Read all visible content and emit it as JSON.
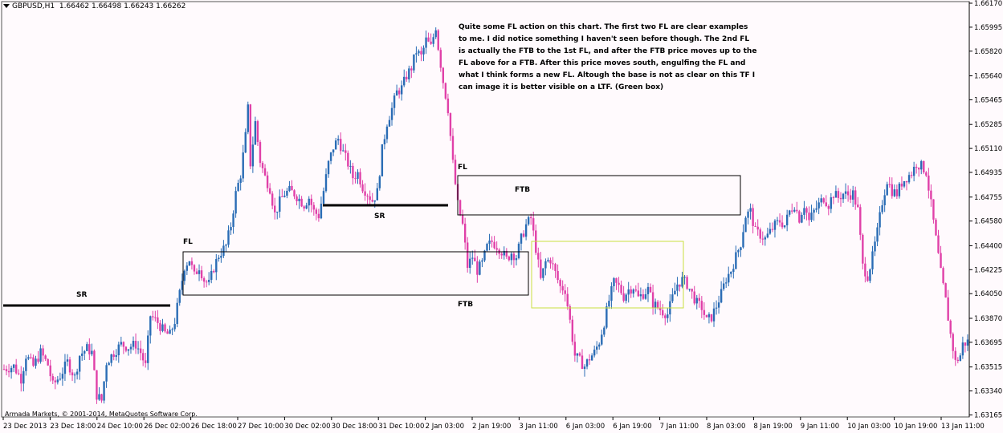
{
  "header": {
    "symbol": "GBPUSD,H1",
    "ohlc": "1.66462 1.66498 1.66243 1.66262"
  },
  "annotation_note": "Quite some FL action on this chart. The first two FL are clear examples to me. I did notice something I haven't seen before though. The 2nd FL is actually the FTB to the 1st FL, and after the FTB price moves up to the FL above for a FTB. After this price moves south, engulfing the FL and what I think forms a new FL. Altough the base is not as clear on this TF I can image it is better visible on a LTF. (Green box)",
  "copyright": "Armada Markets, © 2001-2014, MetaQuotes Software Corp.",
  "colors": {
    "background": "#fffafd",
    "bull_candle": "#2a6cb5",
    "bear_candle": "#e040a8",
    "green_box": "#c8e040",
    "zone_border": "#000000"
  },
  "chart_data": {
    "type": "candlestick",
    "title": "",
    "xlabel": "",
    "ylabel": "",
    "ylim": [
      1.6315,
      1.6617
    ],
    "y_ticks": [
      "1.66170",
      "1.65995",
      "1.65820",
      "1.65640",
      "1.65465",
      "1.65285",
      "1.65110",
      "1.64935",
      "1.64755",
      "1.64580",
      "1.64400",
      "1.64225",
      "1.64050",
      "1.63870",
      "1.63695",
      "1.63515",
      "1.63340",
      "1.63165"
    ],
    "x_ticks": [
      "23 Dec 2013",
      "23 Dec 18:00",
      "24 Dec 10:00",
      "26 Dec 02:00",
      "26 Dec 18:00",
      "27 Dec 10:00",
      "30 Dec 02:00",
      "30 Dec 18:00",
      "31 Dec 10:00",
      "2 Jan 03:00",
      "2 Jan 19:00",
      "3 Jan 11:00",
      "6 Jan 03:00",
      "6 Jan 19:00",
      "7 Jan 11:00",
      "8 Jan 03:00",
      "8 Jan 19:00",
      "9 Jan 11:00",
      "10 Jan 03:00",
      "10 Jan 19:00",
      "13 Jan 11:00"
    ],
    "waypoints": [
      [
        0,
        1.635
      ],
      [
        4,
        1.6352
      ],
      [
        7,
        1.6343
      ],
      [
        9,
        1.636
      ],
      [
        12,
        1.6352
      ],
      [
        15,
        1.6362
      ],
      [
        18,
        1.6353
      ],
      [
        20,
        1.6338
      ],
      [
        23,
        1.6345
      ],
      [
        26,
        1.6355
      ],
      [
        29,
        1.6344
      ],
      [
        31,
        1.636
      ],
      [
        34,
        1.6365
      ],
      [
        36,
        1.6362
      ],
      [
        38,
        1.6331
      ],
      [
        40,
        1.6327
      ],
      [
        42,
        1.6355
      ],
      [
        45,
        1.6362
      ],
      [
        48,
        1.6368
      ],
      [
        51,
        1.6366
      ],
      [
        54,
        1.6368
      ],
      [
        56,
        1.6362
      ],
      [
        58,
        1.6352
      ],
      [
        60,
        1.6389
      ],
      [
        63,
        1.6384
      ],
      [
        66,
        1.6376
      ],
      [
        68,
        1.6375
      ],
      [
        70,
        1.6385
      ],
      [
        72,
        1.6405
      ],
      [
        74,
        1.6425
      ],
      [
        76,
        1.643
      ],
      [
        78,
        1.6418
      ],
      [
        80,
        1.6425
      ],
      [
        82,
        1.6415
      ],
      [
        84,
        1.6412
      ],
      [
        86,
        1.6424
      ],
      [
        88,
        1.6433
      ],
      [
        91,
        1.644
      ],
      [
        93,
        1.6455
      ],
      [
        95,
        1.6478
      ],
      [
        97,
        1.6492
      ],
      [
        99,
        1.652
      ],
      [
        100,
        1.654
      ],
      [
        101,
        1.65
      ],
      [
        103,
        1.653
      ],
      [
        105,
        1.6502
      ],
      [
        107,
        1.649
      ],
      [
        109,
        1.6482
      ],
      [
        111,
        1.6463
      ],
      [
        113,
        1.6472
      ],
      [
        115,
        1.6478
      ],
      [
        117,
        1.648
      ],
      [
        119,
        1.6478
      ],
      [
        121,
        1.6474
      ],
      [
        123,
        1.647
      ],
      [
        125,
        1.6475
      ],
      [
        127,
        1.6465
      ],
      [
        129,
        1.6462
      ],
      [
        131,
        1.648
      ],
      [
        133,
        1.65
      ],
      [
        135,
        1.6512
      ],
      [
        137,
        1.6518
      ],
      [
        139,
        1.6508
      ],
      [
        141,
        1.65
      ],
      [
        143,
        1.649
      ],
      [
        145,
        1.6493
      ],
      [
        147,
        1.6483
      ],
      [
        149,
        1.6478
      ],
      [
        151,
        1.6473
      ],
      [
        153,
        1.6479
      ],
      [
        155,
        1.651
      ],
      [
        157,
        1.653
      ],
      [
        159,
        1.654
      ],
      [
        161,
        1.6552
      ],
      [
        163,
        1.6555
      ],
      [
        165,
        1.6564
      ],
      [
        167,
        1.657
      ],
      [
        169,
        1.6582
      ],
      [
        171,
        1.6578
      ],
      [
        173,
        1.659
      ],
      [
        175,
        1.6585
      ],
      [
        177,
        1.66
      ],
      [
        178,
        1.6585
      ],
      [
        180,
        1.656
      ],
      [
        182,
        1.654
      ],
      [
        184,
        1.65
      ],
      [
        186,
        1.647
      ],
      [
        188,
        1.6455
      ],
      [
        190,
        1.6425
      ],
      [
        192,
        1.6432
      ],
      [
        194,
        1.6422
      ],
      [
        196,
        1.6427
      ],
      [
        198,
        1.6439
      ],
      [
        200,
        1.6443
      ],
      [
        202,
        1.644
      ],
      [
        204,
        1.6436
      ],
      [
        206,
        1.643
      ],
      [
        208,
        1.6435
      ],
      [
        210,
        1.6432
      ],
      [
        212,
        1.6445
      ],
      [
        214,
        1.6455
      ],
      [
        216,
        1.646
      ],
      [
        218,
        1.6438
      ],
      [
        220,
        1.6415
      ],
      [
        222,
        1.6428
      ],
      [
        224,
        1.643
      ],
      [
        226,
        1.642
      ],
      [
        228,
        1.641
      ],
      [
        230,
        1.6408
      ],
      [
        232,
        1.6385
      ],
      [
        234,
        1.636
      ],
      [
        236,
        1.6356
      ],
      [
        238,
        1.6352
      ],
      [
        240,
        1.6358
      ],
      [
        242,
        1.6362
      ],
      [
        244,
        1.637
      ],
      [
        246,
        1.6384
      ],
      [
        248,
        1.64
      ],
      [
        250,
        1.6413
      ],
      [
        252,
        1.641
      ],
      [
        254,
        1.6403
      ],
      [
        256,
        1.6408
      ],
      [
        258,
        1.641
      ],
      [
        260,
        1.6402
      ],
      [
        262,
        1.6405
      ],
      [
        264,
        1.6408
      ],
      [
        266,
        1.6398
      ],
      [
        268,
        1.6395
      ],
      [
        270,
        1.6392
      ],
      [
        272,
        1.639
      ],
      [
        274,
        1.6402
      ],
      [
        276,
        1.6412
      ],
      [
        278,
        1.6415
      ],
      [
        280,
        1.6412
      ],
      [
        282,
        1.6405
      ],
      [
        284,
        1.6398
      ],
      [
        286,
        1.6395
      ],
      [
        288,
        1.6385
      ],
      [
        290,
        1.6388
      ],
      [
        292,
        1.6396
      ],
      [
        294,
        1.6405
      ],
      [
        296,
        1.6416
      ],
      [
        298,
        1.6422
      ],
      [
        300,
        1.6432
      ],
      [
        302,
        1.6442
      ],
      [
        304,
        1.6462
      ],
      [
        306,
        1.6465
      ],
      [
        308,
        1.645
      ],
      [
        310,
        1.6448
      ],
      [
        312,
        1.6445
      ],
      [
        314,
        1.645
      ],
      [
        316,
        1.6455
      ],
      [
        318,
        1.6458
      ],
      [
        320,
        1.6455
      ],
      [
        322,
        1.6465
      ],
      [
        324,
        1.647
      ],
      [
        326,
        1.646
      ],
      [
        328,
        1.647
      ],
      [
        330,
        1.6458
      ],
      [
        332,
        1.6465
      ],
      [
        334,
        1.647
      ],
      [
        336,
        1.6475
      ],
      [
        338,
        1.647
      ],
      [
        340,
        1.6478
      ],
      [
        342,
        1.6475
      ],
      [
        344,
        1.6478
      ],
      [
        346,
        1.6477
      ],
      [
        348,
        1.6478
      ],
      [
        350,
        1.6466
      ],
      [
        352,
        1.6425
      ],
      [
        354,
        1.6418
      ],
      [
        356,
        1.6432
      ],
      [
        358,
        1.645
      ],
      [
        360,
        1.6472
      ],
      [
        362,
        1.6488
      ],
      [
        364,
        1.648
      ],
      [
        366,
        1.6478
      ],
      [
        368,
        1.6486
      ],
      [
        370,
        1.649
      ],
      [
        372,
        1.6493
      ],
      [
        374,
        1.65
      ],
      [
        376,
        1.6498
      ],
      [
        378,
        1.6494
      ],
      [
        380,
        1.647
      ],
      [
        382,
        1.6445
      ],
      [
        384,
        1.642
      ],
      [
        386,
        1.64
      ],
      [
        388,
        1.6375
      ],
      [
        390,
        1.6355
      ],
      [
        392,
        1.636
      ],
      [
        393,
        1.6368
      ],
      [
        395,
        1.637
      ]
    ]
  },
  "zones": {
    "sr_1": "SR",
    "fl_1": "FL",
    "ftb_1": "FTB",
    "sr_2": "SR",
    "fl_2": "FL",
    "ftb_2": "FTB"
  }
}
